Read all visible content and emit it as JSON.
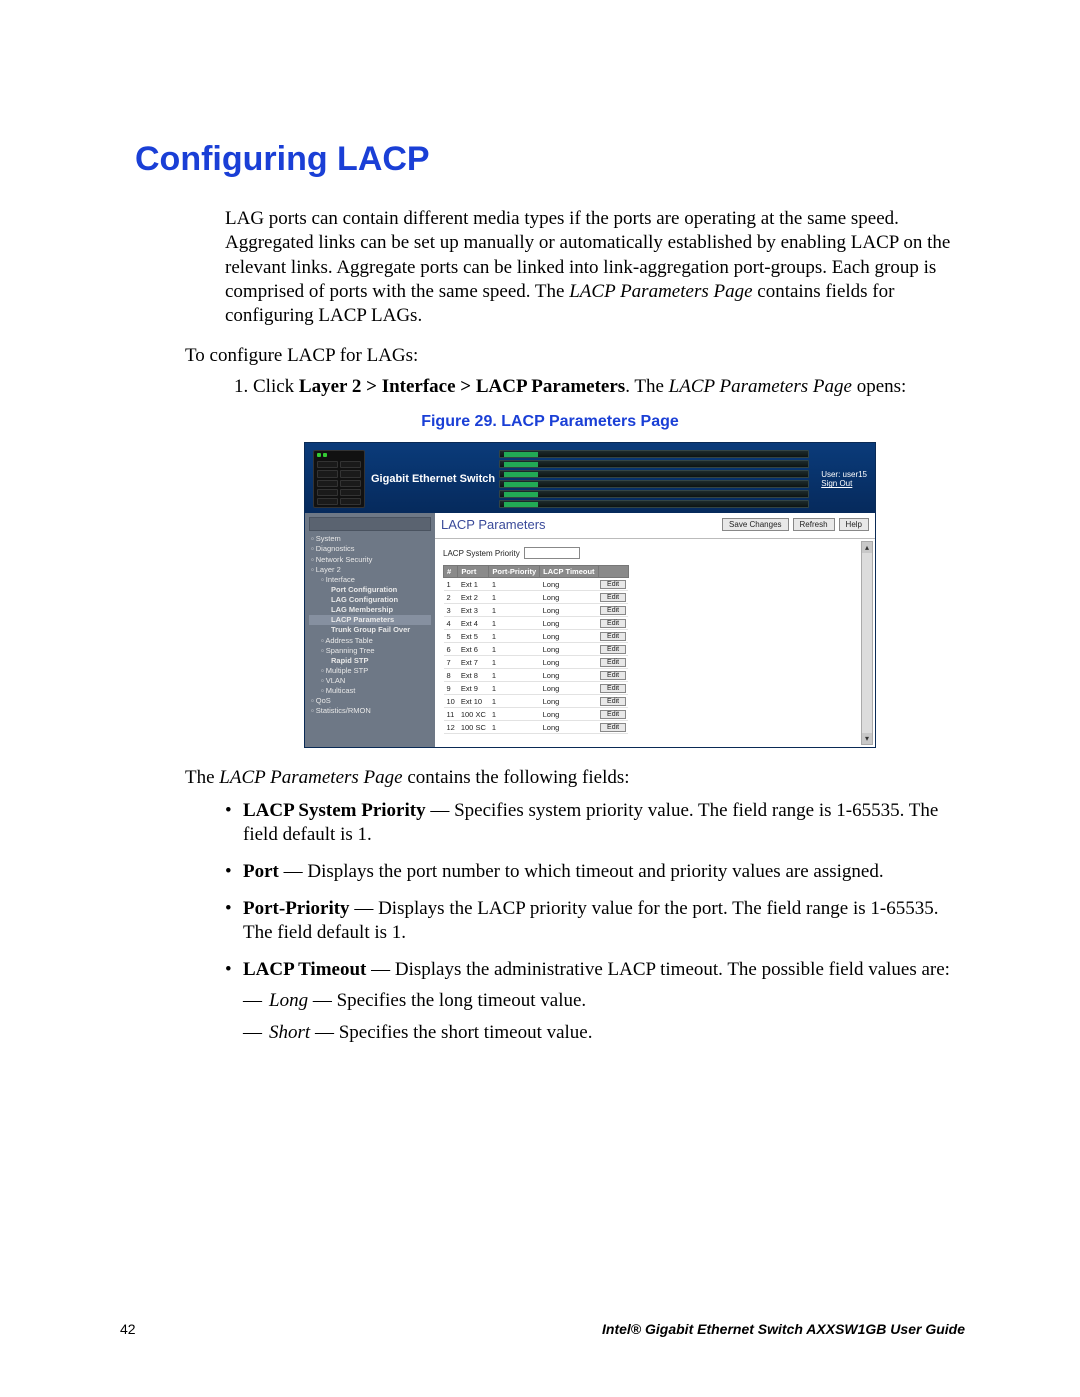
{
  "heading": "Configuring LACP",
  "intro": "LAG ports can contain different media types if the ports are operating at the same speed. Aggregated links can be set up manually or automatically established by enabling LACP on the relevant links. Aggregate ports can be linked into link-aggregation port-groups. Each group is comprised of ports with the same speed. The ",
  "intro_page_ref": "LACP Parameters Page",
  "intro_tail": " contains fields for configuring LACP LAGs.",
  "pre_list": "To configure LACP for LAGs:",
  "step1_pre": "Click ",
  "step1_path": "Layer 2 > Interface > LACP Parameters",
  "step1_mid": ". The ",
  "step1_page_ref": "LACP Parameters Page",
  "step1_post": " opens:",
  "figure_caption": "Figure 29. LACP Parameters Page",
  "screenshot": {
    "brand": "Gigabit Ethernet Switch",
    "user_label": "User: user15",
    "signout": "Sign Out",
    "nav": {
      "system": "System",
      "diagnostics": "Diagnostics",
      "netsec": "Network Security",
      "layer2": "Layer 2",
      "interface": "Interface",
      "port_cfg": "Port Configuration",
      "lag_cfg": "LAG Configuration",
      "lag_mem": "LAG Membership",
      "lacp_params": "LACP Parameters",
      "trunk": "Trunk Group Fail Over",
      "addr_table": "Address Table",
      "spanning": "Spanning Tree",
      "rapid_stp": "Rapid STP",
      "mstp": "Multiple STP",
      "vlan": "VLAN",
      "multicast": "Multicast",
      "qos": "QoS",
      "stats": "Statistics/RMON"
    },
    "main_title": "LACP Parameters",
    "buttons": {
      "save": "Save Changes",
      "refresh": "Refresh",
      "help": "Help",
      "edit": "Edit"
    },
    "priority_label": "LACP System Priority",
    "priority_value": "",
    "table_headers": {
      "num": "#",
      "port": "Port",
      "prio": "Port-Priority",
      "timeout": "LACP Timeout"
    },
    "rows": [
      {
        "n": "1",
        "port": "Ext 1",
        "prio": "1",
        "timeout": "Long"
      },
      {
        "n": "2",
        "port": "Ext 2",
        "prio": "1",
        "timeout": "Long"
      },
      {
        "n": "3",
        "port": "Ext 3",
        "prio": "1",
        "timeout": "Long"
      },
      {
        "n": "4",
        "port": "Ext 4",
        "prio": "1",
        "timeout": "Long"
      },
      {
        "n": "5",
        "port": "Ext 5",
        "prio": "1",
        "timeout": "Long"
      },
      {
        "n": "6",
        "port": "Ext 6",
        "prio": "1",
        "timeout": "Long"
      },
      {
        "n": "7",
        "port": "Ext 7",
        "prio": "1",
        "timeout": "Long"
      },
      {
        "n": "8",
        "port": "Ext 8",
        "prio": "1",
        "timeout": "Long"
      },
      {
        "n": "9",
        "port": "Ext 9",
        "prio": "1",
        "timeout": "Long"
      },
      {
        "n": "10",
        "port": "Ext 10",
        "prio": "1",
        "timeout": "Long"
      },
      {
        "n": "11",
        "port": "100 XC",
        "prio": "1",
        "timeout": "Long"
      },
      {
        "n": "12",
        "port": "100 SC",
        "prio": "1",
        "timeout": "Long"
      }
    ]
  },
  "after_intro_pre": "The ",
  "after_intro_ref": "LACP Parameters Page",
  "after_intro_post": " contains the following fields:",
  "fields": {
    "f1_b": "LACP System Priority",
    "f1_t": " — Specifies system priority value. The field range is 1-65535. The field default is 1.",
    "f2_b": "Port",
    "f2_t": " — Displays the port number to which timeout and priority values are assigned.",
    "f3_b": "Port-Priority",
    "f3_t": " — Displays the LACP priority value for the port. The field range is 1-65535. The field default is 1.",
    "f4_b": "LACP Timeout",
    "f4_t": " — Displays the administrative LACP timeout. The possible field values are:",
    "s1_i": "Long",
    "s1_t": " — Specifies the long timeout value.",
    "s2_i": "Short",
    "s2_t": " — Specifies the short timeout value."
  },
  "footer": {
    "page": "42",
    "book": "Intel® Gigabit Ethernet Switch AXXSW1GB User Guide"
  }
}
